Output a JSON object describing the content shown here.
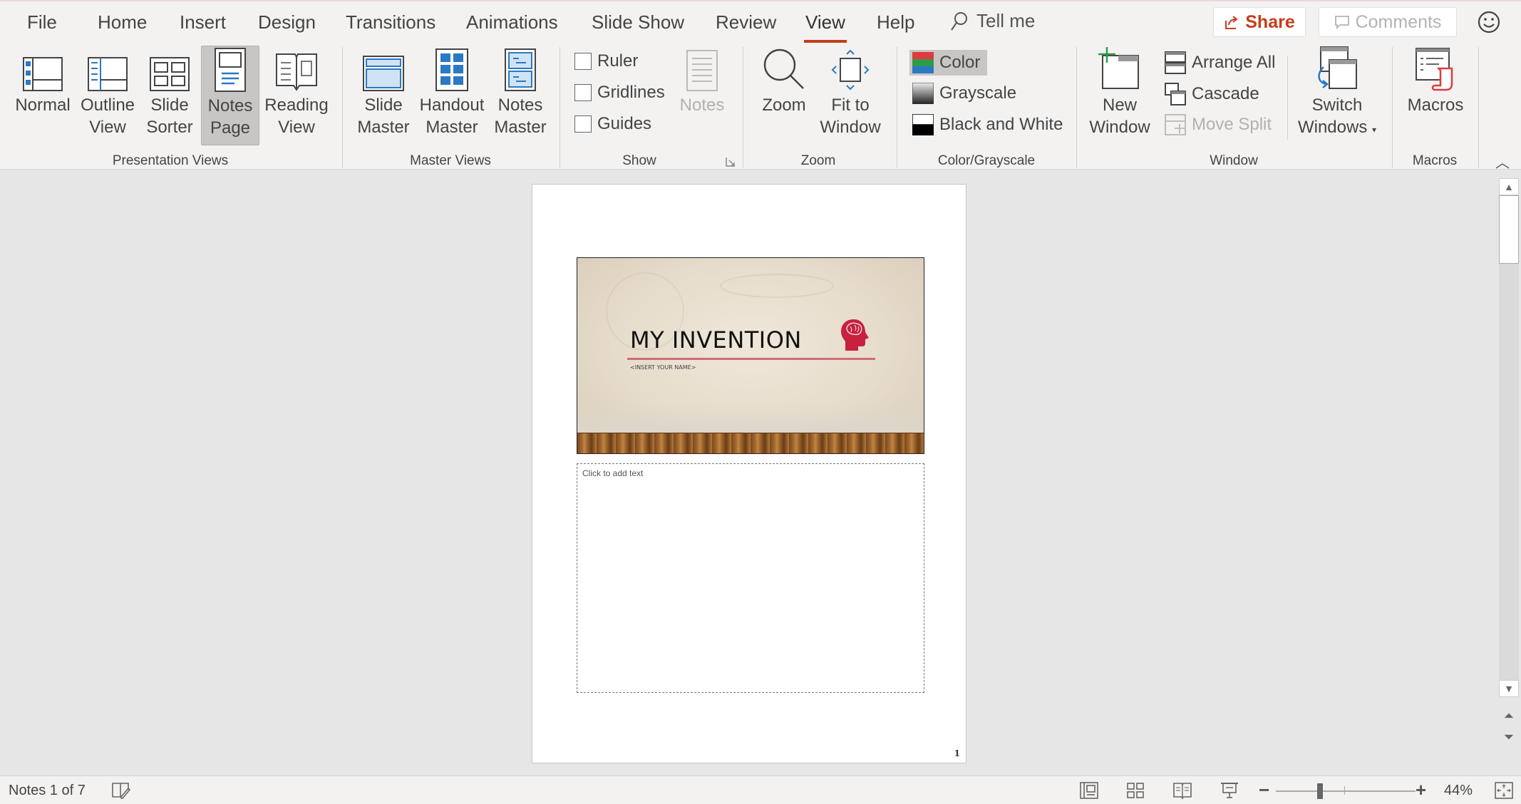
{
  "tabs": [
    {
      "label": "File",
      "active": false
    },
    {
      "label": "Home",
      "active": false
    },
    {
      "label": "Insert",
      "active": false
    },
    {
      "label": "Design",
      "active": false
    },
    {
      "label": "Transitions",
      "active": false
    },
    {
      "label": "Animations",
      "active": false
    },
    {
      "label": "Slide Show",
      "active": false
    },
    {
      "label": "Review",
      "active": false
    },
    {
      "label": "View",
      "active": true
    },
    {
      "label": "Help",
      "active": false
    }
  ],
  "tell_me": {
    "placeholder": "Tell me",
    "icon": "search-icon"
  },
  "share": {
    "label": "Share",
    "icon": "share-icon",
    "color": "#c43e1c"
  },
  "comments": {
    "label": "Comments",
    "icon": "comment-icon"
  },
  "feedback_icon": "smiley-icon",
  "ribbon": {
    "groups": {
      "presentation_views": {
        "label": "Presentation Views",
        "buttons": [
          {
            "line1": "Normal",
            "line2": "",
            "selected": false
          },
          {
            "line1": "Outline",
            "line2": "View",
            "selected": false
          },
          {
            "line1": "Slide",
            "line2": "Sorter",
            "selected": false
          },
          {
            "line1": "Notes",
            "line2": "Page",
            "selected": true
          },
          {
            "line1": "Reading",
            "line2": "View",
            "selected": false
          }
        ]
      },
      "master_views": {
        "label": "Master Views",
        "buttons": [
          {
            "line1": "Slide",
            "line2": "Master"
          },
          {
            "line1": "Handout",
            "line2": "Master"
          },
          {
            "line1": "Notes",
            "line2": "Master"
          }
        ]
      },
      "show": {
        "label": "Show",
        "checkboxes": [
          {
            "label": "Ruler",
            "checked": false
          },
          {
            "label": "Gridlines",
            "checked": false
          },
          {
            "label": "Guides",
            "checked": false
          }
        ],
        "notes_button": {
          "label": "Notes",
          "disabled": true
        }
      },
      "zoom": {
        "label": "Zoom",
        "buttons": [
          {
            "line1": "Zoom",
            "line2": ""
          },
          {
            "line1": "Fit to",
            "line2": "Window"
          }
        ]
      },
      "color_grayscale": {
        "label": "Color/Grayscale",
        "options": [
          {
            "label": "Color",
            "selected": true
          },
          {
            "label": "Grayscale",
            "selected": false
          },
          {
            "label": "Black and White",
            "selected": false
          }
        ]
      },
      "window": {
        "label": "Window",
        "new_window": {
          "line1": "New",
          "line2": "Window"
        },
        "small": [
          {
            "label": "Arrange All",
            "disabled": false
          },
          {
            "label": "Cascade",
            "disabled": false
          },
          {
            "label": "Move Split",
            "disabled": true
          }
        ],
        "switch_windows": {
          "line1": "Switch",
          "line2": "Windows"
        }
      },
      "macros": {
        "label": "Macros",
        "button": {
          "line1": "Macros"
        }
      }
    }
  },
  "document": {
    "slide": {
      "title": "MY INVENTION",
      "subtitle": "<INSERT YOUR NAME>",
      "accent_color": "#c8203f"
    },
    "notes_placeholder": "Click to add text",
    "page_number": "1"
  },
  "status": {
    "notes_position": "Notes 1 of 7",
    "zoom_percent": "44%",
    "zoom_level": 44
  }
}
